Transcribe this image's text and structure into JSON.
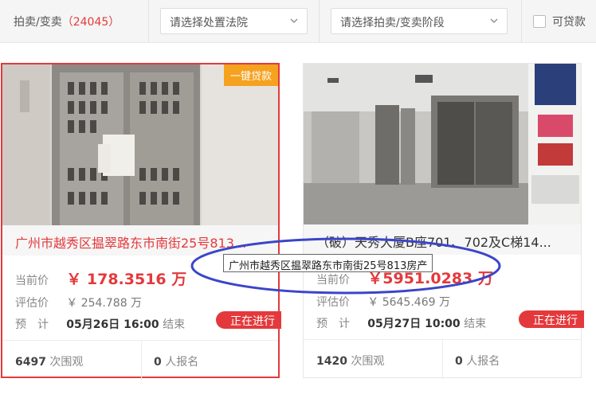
{
  "filter": {
    "label": "拍卖/变卖",
    "count_open": "（",
    "count": "24045",
    "count_close": "）",
    "court_select": "请选择处置法院",
    "stage_select": "请选择拍卖/变卖阶段",
    "loan_label": "可贷款"
  },
  "cards": [
    {
      "badge": "一键贷款",
      "title": "广州市越秀区揾翠路东市南街25号813...",
      "price_label": "当前价",
      "price": "￥ 178.3516 万",
      "est_label": "评估价",
      "est_value": "￥ 254.788 万",
      "time_label": "预　计",
      "time_value": "05月26日 16:00",
      "time_suffix": "结束",
      "status": "正在进行",
      "views": "6497",
      "views_label": "次围观",
      "signups": "0",
      "signups_label": "人报名"
    },
    {
      "title": "（破）天秀大厦B座701、702及C梯14...",
      "price_label": "当前价",
      "price": "￥5951.0283 万",
      "est_label": "评估价",
      "est_value": "￥ 5645.469 万",
      "time_label": "预　计",
      "time_value": "05月27日 10:00",
      "time_suffix": "结束",
      "status": "正在进行",
      "views": "1420",
      "views_label": "次围观",
      "signups": "0",
      "signups_label": "人报名"
    }
  ],
  "tooltip": "广州市越秀区揾翠路东市南街25号813房产",
  "colors": {
    "accent": "#e4393c",
    "badge": "#f4a21f",
    "annotation": "#3b45c8"
  }
}
